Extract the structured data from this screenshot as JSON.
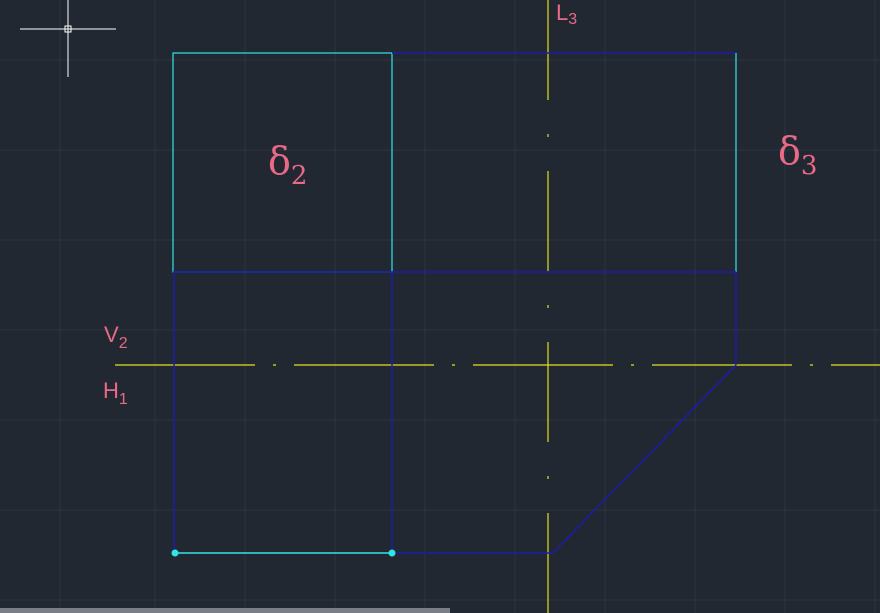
{
  "labels": {
    "l3": {
      "main": "L",
      "sub": "3"
    },
    "v2": {
      "main": "V",
      "sub": "2"
    },
    "h1": {
      "main": "H",
      "sub": "1"
    },
    "delta2": {
      "main": "δ",
      "sub": "2"
    },
    "delta3": {
      "main": "δ",
      "sub": "3"
    }
  },
  "colors": {
    "background": "#222832",
    "grid": "#2e3540",
    "axis": "#e3e01d",
    "cyan": "#2fe6e6",
    "blue": "#1c1caa",
    "label": "#e86a86",
    "crosshair": "#ffffff"
  },
  "icons": {
    "cursor": "crosshair-cursor-icon"
  }
}
